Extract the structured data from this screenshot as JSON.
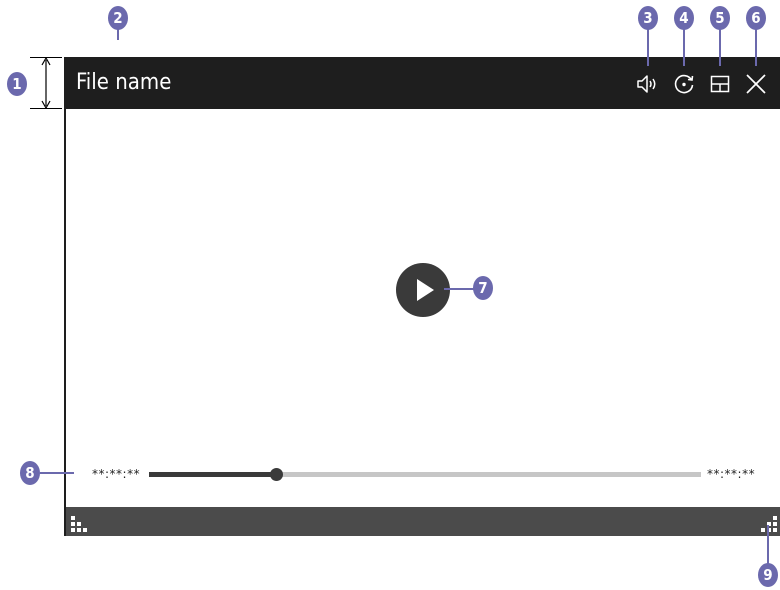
{
  "window": {
    "title": "File name",
    "current_time": "**:**:**",
    "total_time": "**:**:**",
    "progress": 0.23
  },
  "callouts": [
    "1",
    "2",
    "3",
    "4",
    "5",
    "6",
    "7",
    "8",
    "9"
  ],
  "colors": {
    "callout": "#6b69ad",
    "titlebar": "#1e1e1e",
    "progress_fill": "#3a3a3a",
    "progress_track": "#c6c6c6",
    "bottombar": "#4b4b4b"
  },
  "icons": {
    "volume": "volume-icon",
    "rotate": "rotate-icon",
    "layout": "layout-icon",
    "close": "close-icon",
    "play": "play-icon",
    "resize_left": "resize-grip-left-icon",
    "resize_right": "resize-grip-right-icon"
  }
}
